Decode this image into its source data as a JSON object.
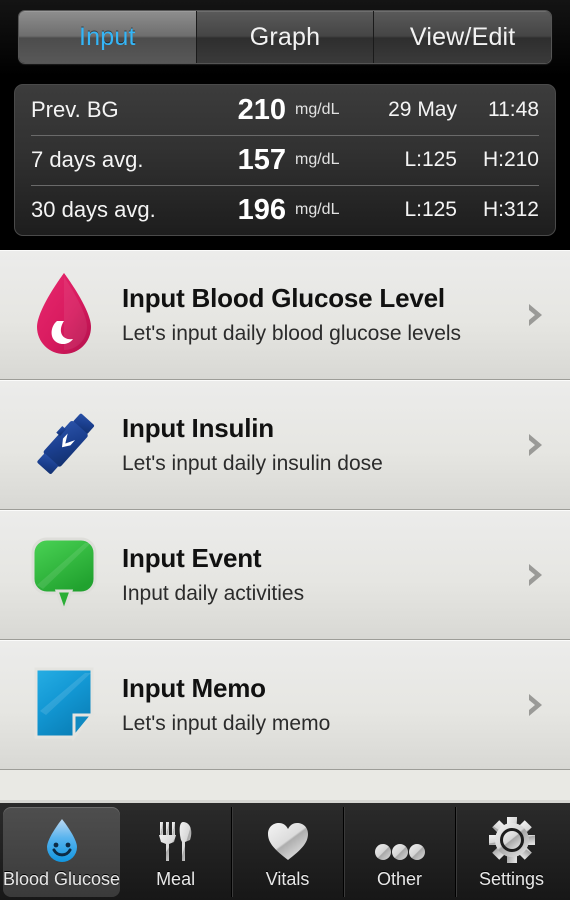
{
  "top_tabs": [
    {
      "label": "Input",
      "active": true
    },
    {
      "label": "Graph",
      "active": false
    },
    {
      "label": "View/Edit",
      "active": false
    }
  ],
  "stats": {
    "rows": [
      {
        "label": "Prev. BG",
        "value": "210",
        "unit": "mg/dL",
        "extra1": "29 May",
        "extra2": "11:48"
      },
      {
        "label": "7 days avg.",
        "value": "157",
        "unit": "mg/dL",
        "extra1": "L:125",
        "extra2": "H:210"
      },
      {
        "label": "30 days avg.",
        "value": "196",
        "unit": "mg/dL",
        "extra1": "L:125",
        "extra2": "H:312"
      }
    ]
  },
  "menu": {
    "rows": [
      {
        "icon": "blood-drop-icon",
        "title": "Input Blood Glucose Level",
        "subtitle": "Let's input daily blood glucose levels",
        "color": "#d81b5f"
      },
      {
        "icon": "insulin-pen-icon",
        "title": "Input Insulin",
        "subtitle": "Let's input daily insulin dose",
        "color": "#1b3f8f"
      },
      {
        "icon": "speech-bubble-icon",
        "title": "Input Event",
        "subtitle": "Input daily activities",
        "color": "#34b944"
      },
      {
        "icon": "memo-page-icon",
        "title": "Input Memo",
        "subtitle": "Let's input daily memo",
        "color": "#1398d4"
      }
    ],
    "chevron": "chevron-right-icon"
  },
  "bottom_tabs": [
    {
      "label": "Blood Glucose",
      "icon": "smiley-droplet-icon",
      "active": true
    },
    {
      "label": "Meal",
      "icon": "fork-knife-icon",
      "active": false
    },
    {
      "label": "Vitals",
      "icon": "heart-icon",
      "active": false
    },
    {
      "label": "Other",
      "icon": "three-dots-icon",
      "active": false
    },
    {
      "label": "Settings",
      "icon": "gear-icon",
      "active": false
    }
  ],
  "colors": {
    "accent_active_tab_text": "#35b6f7",
    "panel_background": "#1d1d1d",
    "list_background": "#e9e9e4"
  }
}
